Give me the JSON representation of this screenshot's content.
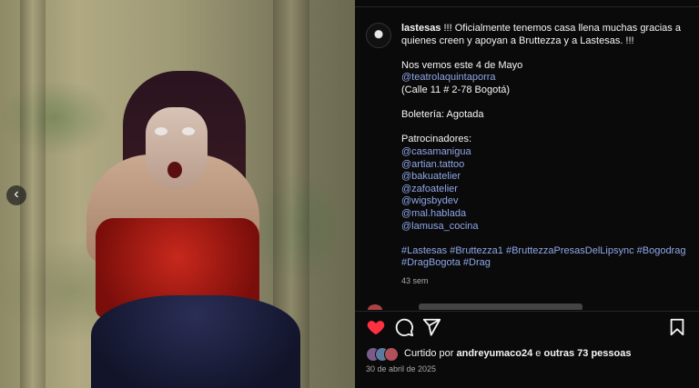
{
  "post": {
    "username": "lastesas",
    "caption_lines": [
      " !!! Oficialmente tenemos casa llena muchas gracias a quienes creen y apoyan a Bruttezza y a Lastesas. !!!",
      "",
      "Nos vemos este 4 de Mayo",
      "@teatrolaquintaporra",
      "(Calle 11 # 2-78 Bogotá)",
      "",
      "Boletería: Agotada",
      "",
      "Patrocinadores:",
      "@casamanigua",
      "@artian.tattoo",
      "@bakuatelier",
      "@zafoatelier",
      "@wigsbydev",
      "@mal.hablada",
      "@lamusa_cocina",
      "",
      "#Lastesas #Bruttezza1 #BruttezzaPresasDelLipsync #Bogodrag #DragBogota #Drag"
    ],
    "line_types": [
      "text",
      "gap",
      "text",
      "link",
      "text",
      "gap",
      "text",
      "gap",
      "text",
      "link",
      "link",
      "link",
      "link",
      "link",
      "link",
      "link",
      "gap",
      "link"
    ],
    "relative_time": "43 sem",
    "liked_by_prefix": "Curtido por ",
    "liked_by_user": "andreyumaco24",
    "liked_by_middle": " e ",
    "liked_by_others": "outras 73 pessoas",
    "date": "30 de abril de 2025"
  },
  "carousel": {
    "prev_glyph": "‹"
  },
  "icons": {
    "like": "heart-icon",
    "comment": "comment-icon",
    "share": "share-icon",
    "save": "bookmark-icon"
  },
  "colors": {
    "like": "#ff3040",
    "link": "#8ea7e8"
  }
}
